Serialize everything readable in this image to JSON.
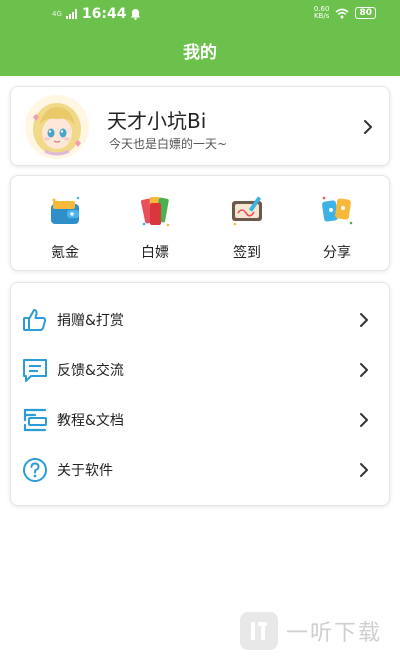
{
  "status_bar": {
    "network": "4G",
    "time": "16:44",
    "speed_value": "0.60",
    "speed_unit": "KB/s",
    "battery": "80"
  },
  "header": {
    "title": "我的"
  },
  "profile": {
    "name": "天才小坑Bi",
    "signature": "今天也是白嫖的一天~"
  },
  "quick_actions": [
    {
      "label": "氪金",
      "icon": "wallet-icon"
    },
    {
      "label": "白嫖",
      "icon": "cards-icon"
    },
    {
      "label": "签到",
      "icon": "sign-board-icon"
    },
    {
      "label": "分享",
      "icon": "share-icon"
    }
  ],
  "menu": [
    {
      "label": "捐赠&打赏",
      "icon": "thumbs-up-icon"
    },
    {
      "label": "反馈&交流",
      "icon": "message-icon"
    },
    {
      "label": "教程&文档",
      "icon": "document-icon"
    },
    {
      "label": "关于软件",
      "icon": "help-icon"
    }
  ],
  "watermark": {
    "text": "一听下载"
  },
  "colors": {
    "header_bg": "#6cc14c",
    "menu_icon": "#2a9dd6",
    "chevron": "#333333"
  }
}
